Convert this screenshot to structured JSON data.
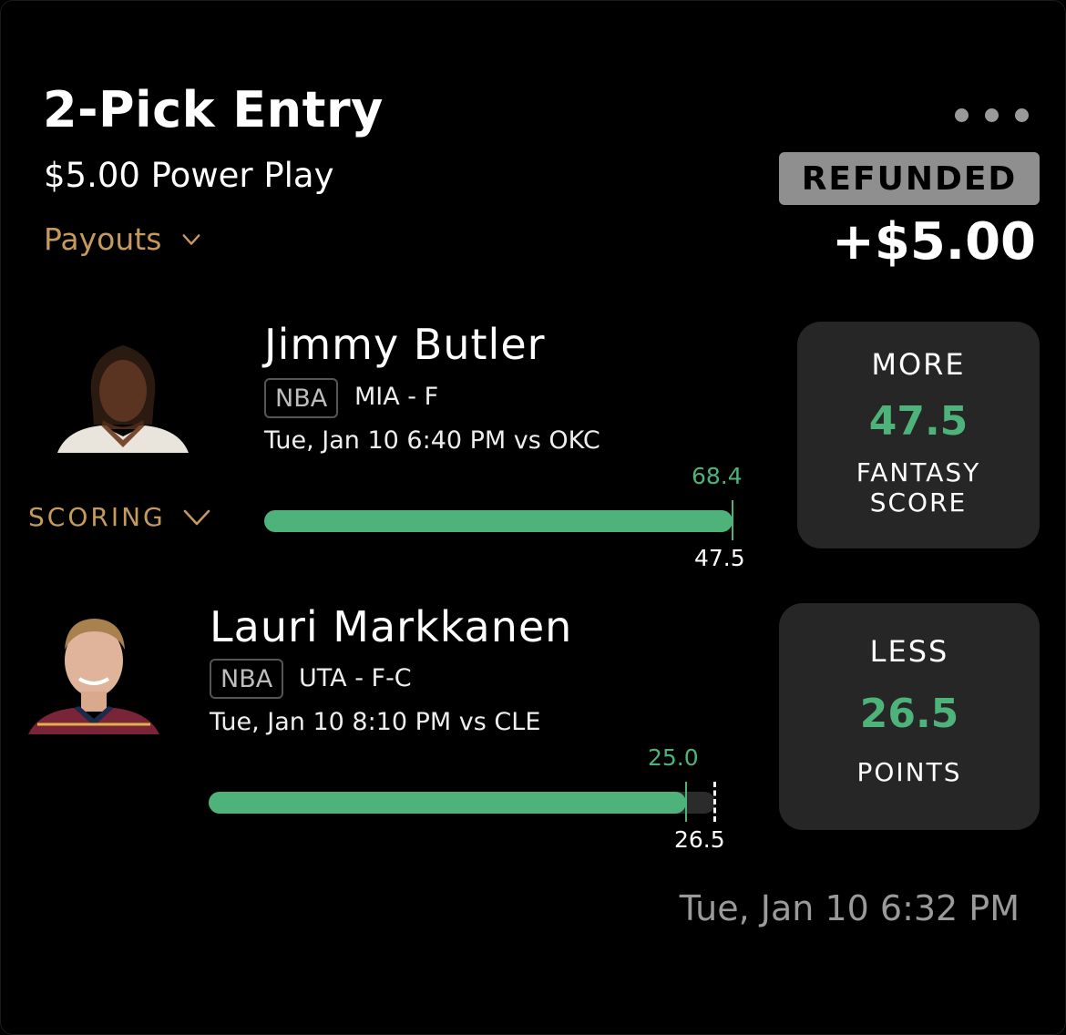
{
  "entry": {
    "title": "2-Pick Entry",
    "subtitle": "$5.00 Power Play",
    "payouts_label": "Payouts",
    "status": "REFUNDED",
    "amount": "+$5.00",
    "timestamp": "Tue, Jan 10 6:32 PM"
  },
  "scoring_label": "SCORING",
  "colors": {
    "accent_gold": "#c69a5c",
    "accent_green": "#4db37a",
    "badge_gray": "#8f8f8f",
    "panel": "#262626"
  },
  "picks": [
    {
      "player": "Jimmy Butler",
      "league": "NBA",
      "team_pos": "MIA - F",
      "game": "Tue, Jan 10 6:40 PM  vs OKC",
      "actual": "68.4",
      "line_label": "47.5",
      "direction": "MORE",
      "line": "47.5",
      "stat_line1": "FANTASY",
      "stat_line2": "SCORE",
      "progress_fraction": 1.0
    },
    {
      "player": "Lauri Markkanen",
      "league": "NBA",
      "team_pos": "UTA - F-C",
      "game": "Tue, Jan 10 8:10 PM  vs CLE",
      "actual": "25.0",
      "line_label": "26.5",
      "direction": "LESS",
      "line": "26.5",
      "stat_line1": "POINTS",
      "stat_line2": "",
      "progress_fraction": 0.943
    }
  ]
}
